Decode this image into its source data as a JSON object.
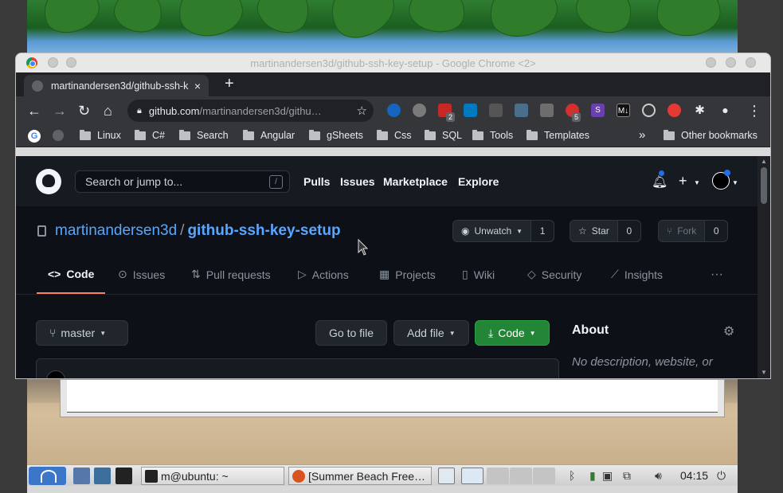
{
  "window": {
    "title": "martinandersen3d/github-ssh-key-setup - Google Chrome <2>"
  },
  "tab": {
    "title": "martinandersen3d/github-ssh-k",
    "close": "×",
    "new_tab": "+"
  },
  "toolbar": {
    "back": "←",
    "forward": "→",
    "reload": "↻",
    "home": "⌂",
    "url_host": "github.com",
    "url_path": "/martinandersen3d/githu…",
    "star": "☆",
    "menu": "⋮",
    "extension_badges": [
      "2",
      "5"
    ]
  },
  "bookmarks": {
    "items": [
      "Linux",
      "C#",
      "Search",
      "Angular",
      "gSheets",
      "Css",
      "SQL",
      "Tools",
      "Templates"
    ],
    "overflow": "»",
    "other": "Other bookmarks"
  },
  "github": {
    "search_placeholder": "Search or jump to...",
    "search_shortcut": "/",
    "nav": [
      "Pulls",
      "Issues",
      "Marketplace",
      "Explore"
    ],
    "plus": "+",
    "repo_owner": "martinandersen3d",
    "repo_sep": "/",
    "repo_name": "github-ssh-key-setup",
    "unwatch_label": "Unwatch",
    "unwatch_count": "1",
    "star_label": "Star",
    "star_count": "0",
    "fork_label": "Fork",
    "fork_count": "0",
    "tabs": [
      "Code",
      "Issues",
      "Pull requests",
      "Actions",
      "Projects",
      "Wiki",
      "Security",
      "Insights"
    ],
    "tab_icons": [
      "<>",
      "⊙",
      "⇅",
      "▷",
      "▦",
      "▯",
      "◇",
      "⟋"
    ],
    "more": "···",
    "branch": "master",
    "go_to_file": "Go to file",
    "add_file": "Add file",
    "code_button": "Code",
    "about_title": "About",
    "about_desc": "No description, website, or"
  },
  "taskbar": {
    "terminal_task": "m@ubuntu: ~",
    "browser_task": "[Summer Beach Free…",
    "clock": "04:15"
  },
  "colors": {
    "github_bg": "#0d1117",
    "github_header": "#161b22",
    "link_blue": "#58a6ff",
    "green_button": "#238636",
    "active_tab_underline": "#f78166",
    "chrome_dark": "#202124",
    "chrome_toolbar": "#35363a"
  }
}
